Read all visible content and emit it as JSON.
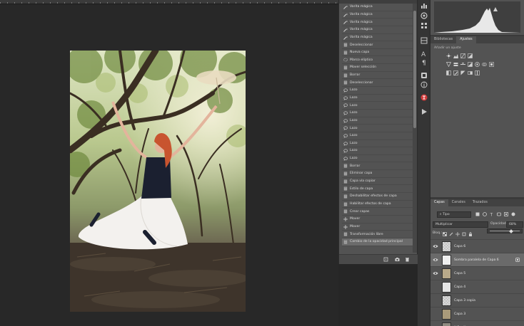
{
  "history": {
    "items": [
      {
        "label": "Varita mágica",
        "icon": "magic-wand-icon"
      },
      {
        "label": "Varita mágica",
        "icon": "magic-wand-icon"
      },
      {
        "label": "Varita mágica",
        "icon": "magic-wand-icon"
      },
      {
        "label": "Varita mágica",
        "icon": "magic-wand-icon"
      },
      {
        "label": "Varita mágica",
        "icon": "magic-wand-icon"
      },
      {
        "label": "Deseleccionar",
        "icon": "document-icon"
      },
      {
        "label": "Nueva capa",
        "icon": "document-icon"
      },
      {
        "label": "Marco elíptico",
        "icon": "ellipse-marquee-icon"
      },
      {
        "label": "Mover selección",
        "icon": "document-icon"
      },
      {
        "label": "Borrar",
        "icon": "document-icon"
      },
      {
        "label": "Deseleccionar",
        "icon": "document-icon"
      },
      {
        "label": "Lazo",
        "icon": "lasso-icon"
      },
      {
        "label": "Lazo",
        "icon": "lasso-icon"
      },
      {
        "label": "Lazo",
        "icon": "lasso-icon"
      },
      {
        "label": "Lazo",
        "icon": "lasso-icon"
      },
      {
        "label": "Lazo",
        "icon": "lasso-icon"
      },
      {
        "label": "Lazo",
        "icon": "lasso-icon"
      },
      {
        "label": "Lazo",
        "icon": "lasso-icon"
      },
      {
        "label": "Lazo",
        "icon": "lasso-icon"
      },
      {
        "label": "Lazo",
        "icon": "lasso-icon"
      },
      {
        "label": "Lazo",
        "icon": "lasso-icon"
      },
      {
        "label": "Borrar",
        "icon": "document-icon"
      },
      {
        "label": "Eliminar capa",
        "icon": "document-icon"
      },
      {
        "label": "Capa vía copiar",
        "icon": "document-icon"
      },
      {
        "label": "Estilo de capa",
        "icon": "document-icon"
      },
      {
        "label": "Deshabilitar efectos de capa",
        "icon": "document-icon"
      },
      {
        "label": "Habilitar efectos de capa",
        "icon": "document-icon"
      },
      {
        "label": "Crear capas",
        "icon": "document-icon"
      },
      {
        "label": "Mover",
        "icon": "move-icon"
      },
      {
        "label": "Mover",
        "icon": "move-icon"
      },
      {
        "label": "Transformación libre",
        "icon": "document-icon"
      },
      {
        "label": "Cambio de la opacidad principal",
        "icon": "document-icon"
      }
    ],
    "selected_index": 31
  },
  "adjustments": {
    "tabs": [
      "Bibliotecas",
      "Ajustes"
    ],
    "active_tab": "Ajustes",
    "hint": "Añadir un ajuste"
  },
  "layers": {
    "tabs": [
      "Capas",
      "Canales",
      "Trazados"
    ],
    "active_tab": "Capas",
    "filter_value": "Tipo",
    "blend_mode": "Multiplicar",
    "opacity_label": "Opacidad:",
    "opacity_value": "68%",
    "lock_label": "Bloq.:",
    "items": [
      {
        "name": "Capa 6",
        "visible": true,
        "selected": false
      },
      {
        "name": "Sombra paralela de Capa 6",
        "visible": true,
        "selected": true
      },
      {
        "name": "Capa 5",
        "visible": true,
        "selected": false
      },
      {
        "name": "Capa 4",
        "visible": false,
        "selected": false
      },
      {
        "name": "Capa 3 copia",
        "visible": false,
        "selected": false
      },
      {
        "name": "Capa 3",
        "visible": false,
        "selected": false
      },
      {
        "name": "V-Pro II",
        "visible": false,
        "selected": false
      }
    ]
  },
  "colors": {
    "panel": "#535353",
    "canvas_bg": "#282828",
    "selected_row": "#6a6a6a",
    "history_icon_red": "#d23b3b"
  }
}
